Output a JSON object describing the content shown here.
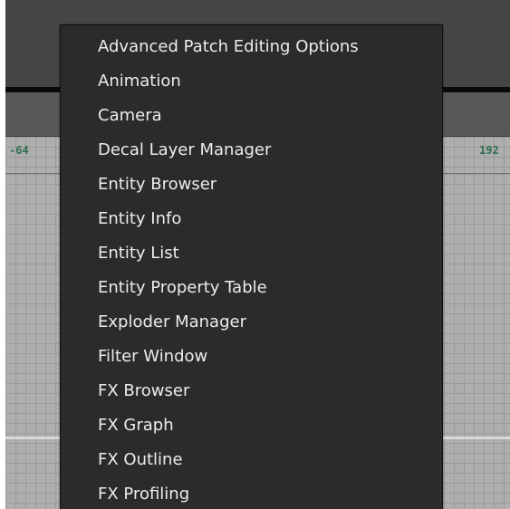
{
  "viewport": {
    "coord_left": "-64",
    "coord_right": "192"
  },
  "menu": {
    "items": [
      {
        "label": "Advanced Patch Editing Options"
      },
      {
        "label": "Animation"
      },
      {
        "label": "Camera"
      },
      {
        "label": "Decal Layer Manager"
      },
      {
        "label": "Entity Browser"
      },
      {
        "label": "Entity Info"
      },
      {
        "label": "Entity List"
      },
      {
        "label": "Entity Property Table"
      },
      {
        "label": "Exploder Manager"
      },
      {
        "label": "Filter Window"
      },
      {
        "label": "FX Browser"
      },
      {
        "label": "FX Graph"
      },
      {
        "label": "FX Outline"
      },
      {
        "label": "FX Profiling"
      }
    ]
  }
}
